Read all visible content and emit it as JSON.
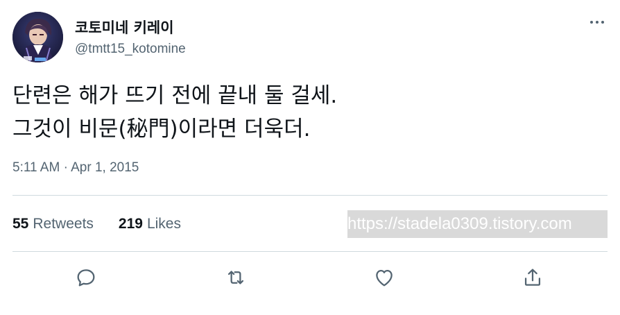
{
  "author": {
    "display_name": "코토미네 키레이",
    "handle": "@tmtt15_kotomine",
    "avatar": "avatar"
  },
  "header": {
    "more_icon": "more-horizontal-icon"
  },
  "tweet": {
    "lines": [
      "단련은 해가 뜨기 전에 끝내 둘 걸세.",
      "그것이 비문(秘門)이라면 더욱더."
    ],
    "timestamp": "5:11 AM · Apr 1, 2015"
  },
  "stats": {
    "retweets_count": "55",
    "retweets_label": "Retweets",
    "likes_count": "219",
    "likes_label": "Likes"
  },
  "watermark": "https://stadela0309.tistory.com",
  "actions": [
    {
      "icon": "reply-icon"
    },
    {
      "icon": "retweet-icon"
    },
    {
      "icon": "like-icon"
    },
    {
      "icon": "share-icon"
    }
  ],
  "colors": {
    "text_primary": "#0f1419",
    "text_secondary": "#536471",
    "divider": "#cfd9de",
    "watermark_bg": "#d9d9d9"
  }
}
